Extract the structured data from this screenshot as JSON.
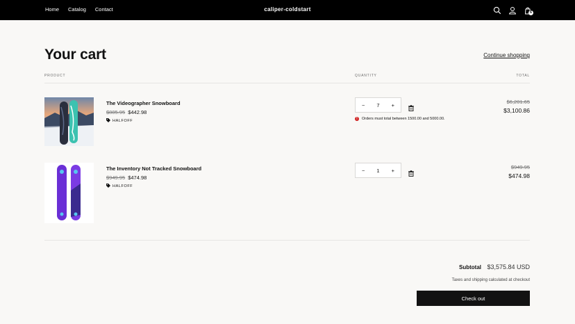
{
  "header": {
    "nav": [
      "Home",
      "Catalog",
      "Contact"
    ],
    "brand": "caliper-coldstart",
    "cart_count": "6",
    "icons": [
      "search-icon",
      "account-icon",
      "cart-icon"
    ]
  },
  "page": {
    "title": "Your cart",
    "continue_label": "Continue shopping",
    "columns": {
      "product": "PRODUCT",
      "quantity": "QUANTITY",
      "total": "TOTAL"
    }
  },
  "items": [
    {
      "name": "The Videographer Snowboard",
      "compare_price": "$885.95",
      "price": "$442.98",
      "discount": "HALFOFF",
      "quantity": "7",
      "error": "Orders must total between 1500.00 and 5000.00.",
      "total_old": "$6,201.65",
      "total_new": "$3,100.86"
    },
    {
      "name": "The Inventory Not Tracked Snowboard",
      "compare_price": "$949.95",
      "price": "$474.98",
      "discount": "HALFOFF",
      "quantity": "1",
      "error": "",
      "total_old": "$949.95",
      "total_new": "$474.98"
    }
  ],
  "summary": {
    "subtotal_label": "Subtotal",
    "subtotal_value": "$3,575.84 USD",
    "taxes_note": "Taxes and shipping calculated at checkout",
    "checkout_label": "Check out"
  },
  "colors": {
    "header_bg": "#000000",
    "page_bg": "#f9f8f6",
    "button_bg": "#121212",
    "error": "#d12424"
  }
}
